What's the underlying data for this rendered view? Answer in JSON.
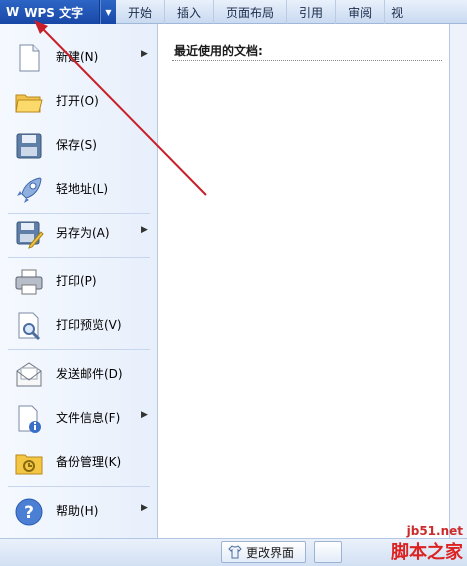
{
  "app": {
    "title": "WPS 文字",
    "logo_text": "W"
  },
  "tabs": [
    {
      "label": "开始"
    },
    {
      "label": "插入"
    },
    {
      "label": "页面布局"
    },
    {
      "label": "引用"
    },
    {
      "label": "审阅"
    },
    {
      "label": "视"
    }
  ],
  "menu": [
    {
      "label": "新建(N)",
      "icon": "new-document-icon",
      "has_submenu": true
    },
    {
      "label": "打开(O)",
      "icon": "open-folder-icon",
      "has_submenu": false
    },
    {
      "label": "保存(S)",
      "icon": "save-disk-icon",
      "has_submenu": false
    },
    {
      "label": "轻地址(L)",
      "icon": "rocket-icon",
      "has_submenu": false
    },
    {
      "label": "另存为(A)",
      "icon": "save-as-icon",
      "has_submenu": true
    },
    {
      "label": "打印(P)",
      "icon": "printer-icon",
      "has_submenu": false
    },
    {
      "label": "打印预览(V)",
      "icon": "print-preview-icon",
      "has_submenu": false
    },
    {
      "label": "发送邮件(D)",
      "icon": "mail-icon",
      "has_submenu": false
    },
    {
      "label": "文件信息(F)",
      "icon": "file-info-icon",
      "has_submenu": true
    },
    {
      "label": "备份管理(K)",
      "icon": "backup-folder-icon",
      "has_submenu": false
    },
    {
      "label": "帮助(H)",
      "icon": "help-icon",
      "has_submenu": true
    }
  ],
  "recent": {
    "title": "最近使用的文档:"
  },
  "bottom": {
    "change_ui_label": "更改界面"
  },
  "watermark": {
    "site": "jb51.net",
    "text": "脚本之家"
  },
  "colors": {
    "app_button": "#1f56b8",
    "annotation_arrow": "#c8202a",
    "watermark": "#d22222"
  }
}
